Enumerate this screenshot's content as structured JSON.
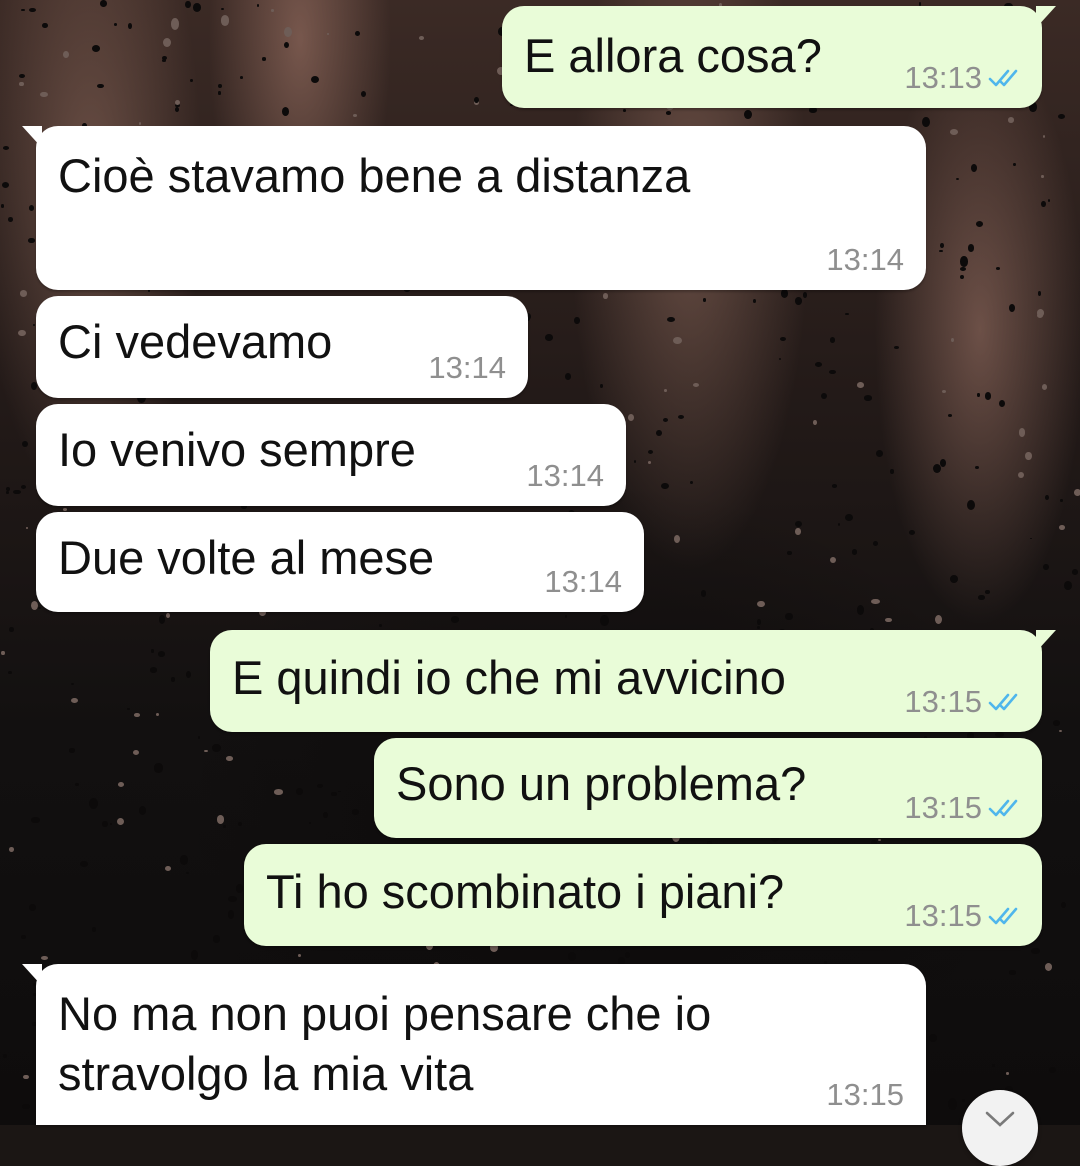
{
  "conversation": {
    "messages": [
      {
        "direction": "outgoing",
        "text": "E allora cosa?",
        "time": "13:13",
        "status": "read"
      },
      {
        "direction": "incoming",
        "text": "Cioè stavamo bene a distanza",
        "time": "13:14"
      },
      {
        "direction": "incoming",
        "text": "Ci vedevamo",
        "time": "13:14"
      },
      {
        "direction": "incoming",
        "text": "Io venivo sempre",
        "time": "13:14"
      },
      {
        "direction": "incoming",
        "text": "Due volte al mese",
        "time": "13:14"
      },
      {
        "direction": "outgoing",
        "text": "E quindi io che mi avvicino",
        "time": "13:15",
        "status": "read"
      },
      {
        "direction": "outgoing",
        "text": "Sono un problema?",
        "time": "13:15",
        "status": "read"
      },
      {
        "direction": "outgoing",
        "text": "Ti ho scombinato i piani?",
        "time": "13:15",
        "status": "read"
      },
      {
        "direction": "incoming",
        "text_lines": [
          "No ma non puoi pensare che io",
          "stravolgo la mia vita"
        ],
        "time": "13:15"
      }
    ]
  },
  "colors": {
    "incoming_bubble": "#ffffff",
    "outgoing_bubble": "#e9fcd8",
    "read_ticks": "#4fb6ec",
    "timestamp": "#8f8f8f"
  },
  "icons": {
    "read_receipt": "double-check-icon",
    "scroll_down": "chevron-down-icon"
  }
}
